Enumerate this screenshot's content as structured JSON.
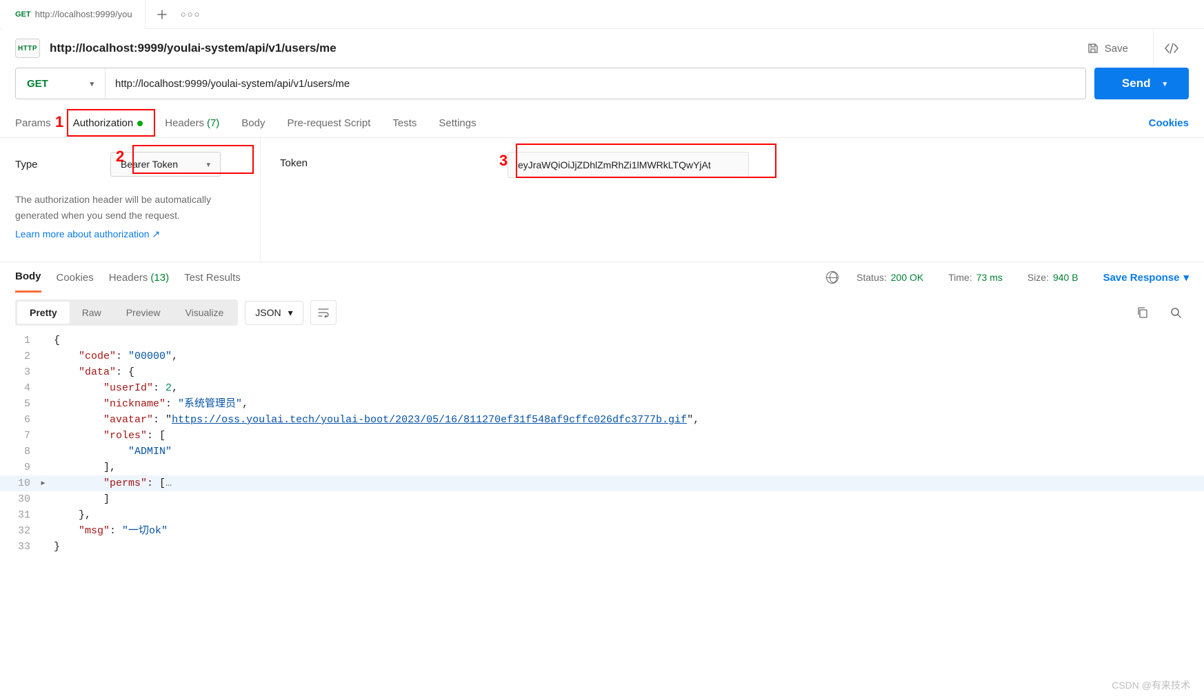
{
  "tabbar": {
    "tabs": [
      {
        "method": "GET",
        "title": "http://localhost:9999/you"
      }
    ]
  },
  "header": {
    "badge": "HTTP",
    "title": "http://localhost:9999/youlai-system/api/v1/users/me",
    "save": "Save"
  },
  "request": {
    "method": "GET",
    "url": "http://localhost:9999/youlai-system/api/v1/users/me",
    "send": "Send",
    "tabs": {
      "params": "Params",
      "authorization": "Authorization",
      "headers": "Headers",
      "headers_count": "(7)",
      "body": "Body",
      "prereq": "Pre-request Script",
      "tests": "Tests",
      "settings": "Settings"
    },
    "cookies_link": "Cookies"
  },
  "auth": {
    "type_label": "Type",
    "type_value": "Bearer Token",
    "help_line1": "The authorization header will be automatically",
    "help_line2": "generated when you send the request.",
    "learn_more": "Learn more about authorization ↗",
    "token_label": "Token",
    "token_value": "eyJraWQiOiJjZDhlZmRhZi1lMWRkLTQwYjAt"
  },
  "callouts": {
    "one": "1",
    "two": "2",
    "three": "3"
  },
  "response": {
    "tabs": {
      "body": "Body",
      "cookies": "Cookies",
      "headers": "Headers",
      "headers_count": "(13)",
      "test_results": "Test Results"
    },
    "status_label": "Status:",
    "status_value": "200 OK",
    "time_label": "Time:",
    "time_value": "73 ms",
    "size_label": "Size:",
    "size_value": "940 B",
    "save_response": "Save Response",
    "toolbar": {
      "pretty": "Pretty",
      "raw": "Raw",
      "preview": "Preview",
      "visualize": "Visualize",
      "format": "JSON"
    },
    "json": {
      "code": "00000",
      "data": {
        "userId": 2,
        "nickname": "系统管理员",
        "avatar": "https://oss.youlai.tech/youlai-boot/2023/05/16/811270ef31f548af9cffc026dfc3777b.gif",
        "roles": [
          "ADMIN"
        ],
        "perms_collapsed": true
      },
      "msg": "一切ok"
    }
  },
  "watermark": "CSDN @有来技术"
}
